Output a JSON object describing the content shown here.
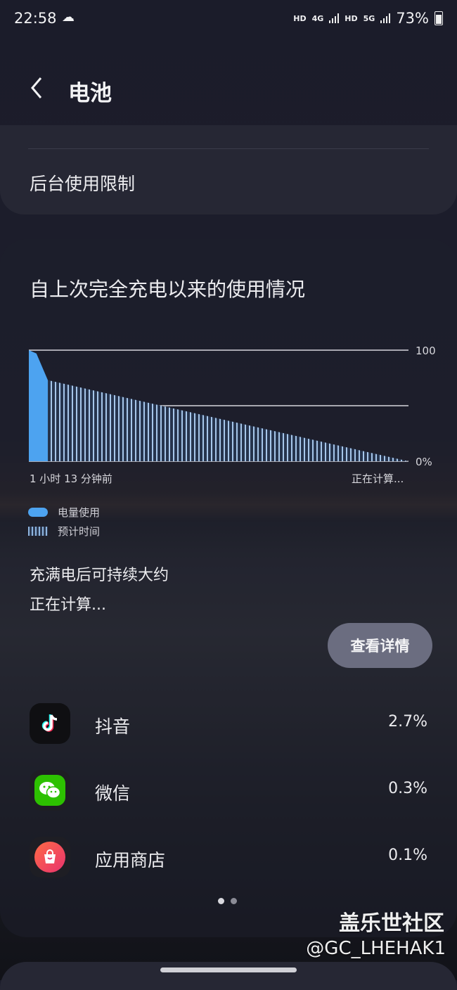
{
  "status_bar": {
    "time": "22:58",
    "hd1": "HD",
    "net1": "4G",
    "hd2": "HD",
    "net2": "5G",
    "battery_percent": "73%"
  },
  "header": {
    "title": "电池"
  },
  "settings_card": {
    "item_background_limit": "后台使用限制"
  },
  "usage_card": {
    "title": "自上次完全充电以来的使用情况",
    "legend": {
      "usage": "电量使用",
      "estimate": "预计时间"
    },
    "full_charge_label": "充满电后可持续大约",
    "full_charge_value": "正在计算...",
    "details_button": "查看详情"
  },
  "chart_data": {
    "type": "area",
    "y_axis_labels": [
      "100",
      "0%"
    ],
    "x_axis_labels": [
      "1 小时 13 分钟前",
      "正在计算..."
    ],
    "ylim": [
      0,
      100
    ],
    "gridlines": [
      100,
      50
    ],
    "series": [
      {
        "name": "电量使用",
        "style": "solid",
        "color": "#4da3f0",
        "x": [
          0,
          0.02,
          0.05
        ],
        "y": [
          100,
          97,
          73
        ]
      },
      {
        "name": "预计时间",
        "style": "hatched",
        "color": "#8fb6e0",
        "x": [
          0.05,
          1.0
        ],
        "y": [
          73,
          0
        ]
      }
    ]
  },
  "apps": [
    {
      "name": "抖音",
      "percent": "2.7%",
      "icon": "tiktok-icon",
      "icon_color": "#111111"
    },
    {
      "name": "微信",
      "percent": "0.3%",
      "icon": "wechat-icon",
      "icon_color": "#2dc100"
    },
    {
      "name": "应用商店",
      "percent": "0.1%",
      "icon": "app-store-icon",
      "icon_color": "#f0485c"
    }
  ],
  "pager": {
    "count": 2,
    "active": 0
  },
  "watermark": {
    "line1": "盖乐世社区",
    "line2": "@GC_LHEHAK1"
  }
}
